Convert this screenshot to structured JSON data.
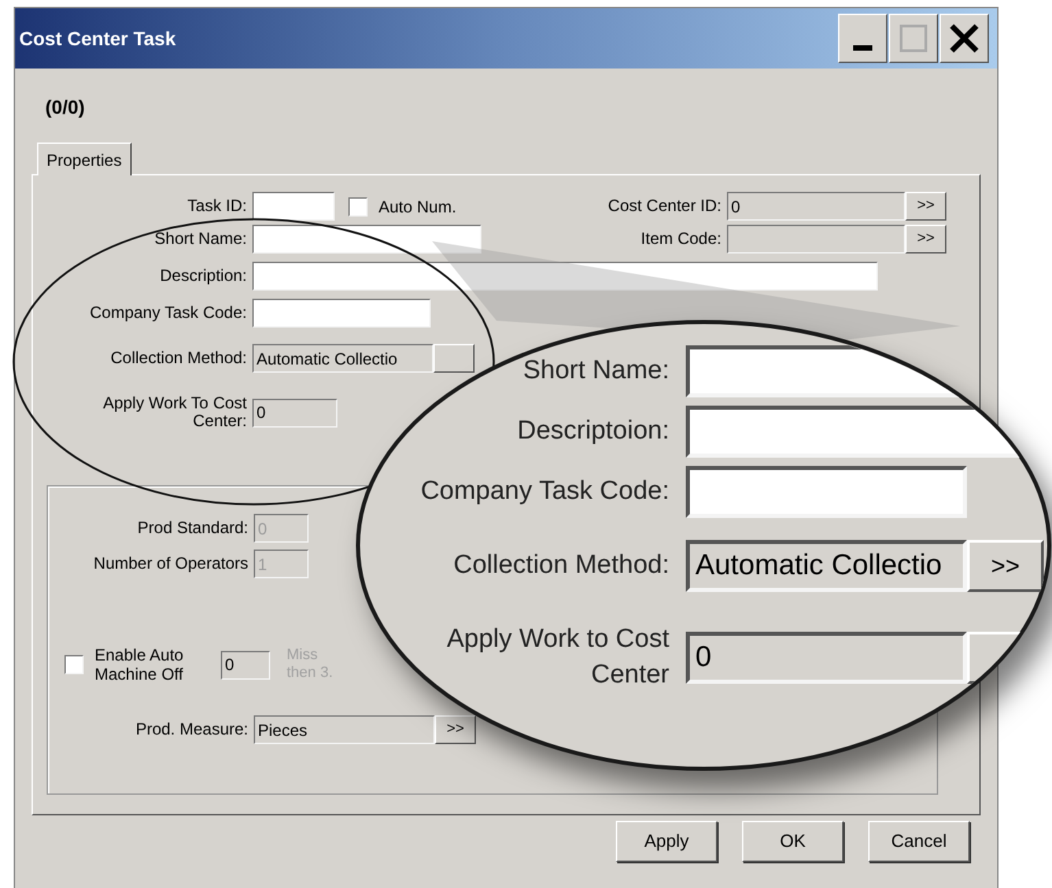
{
  "window": {
    "title": "Cost Center Task"
  },
  "record_counter": "(0/0)",
  "tabs": [
    {
      "label": "Properties",
      "selected": true
    }
  ],
  "task_id": {
    "label": "Task ID:"
  },
  "auto_num": {
    "label": "Auto Num.",
    "checked": false
  },
  "cost_center_id": {
    "label": "Cost Center ID:",
    "value": "0",
    "button": ">>"
  },
  "item_code": {
    "label": "Item Code:",
    "button": ">>"
  },
  "short_name": {
    "label": "Short Name:"
  },
  "description": {
    "label": "Description:"
  },
  "company_task_code": {
    "label": "Company Task Code:"
  },
  "collection_method": {
    "label": "Collection Method:",
    "value": "Automatic  Collectio"
  },
  "apply_work": {
    "label": "Apply Work To Cost Center:",
    "value": "0"
  },
  "production": {
    "prod_standard": {
      "label": "Prod Standard:",
      "value": "0",
      "disabled": true
    },
    "operators": {
      "label": "Number of Operators",
      "value": "1",
      "disabled": true
    },
    "auto_machine_off": {
      "label": "Enable Auto Machine Off",
      "checked": false,
      "value": "0",
      "hint": [
        "Miss",
        "then 3."
      ]
    },
    "prod_measure": {
      "label": "Prod. Measure:",
      "value": "Pieces",
      "button": ">>"
    }
  },
  "buttons": [
    "Apply",
    "OK",
    "Cancel"
  ],
  "magnifier": {
    "rows": [
      {
        "kind": "text",
        "label": "Short Name:"
      },
      {
        "kind": "text",
        "label": "Descriptoion:"
      },
      {
        "kind": "short",
        "label": "Company Task Code:"
      },
      {
        "kind": "lookup",
        "label": "Collection Method:",
        "value": "Automatic  Collectio",
        "button": ">>"
      },
      {
        "kind": "lookup",
        "label": "Apply Work to Cost Center",
        "value": "0"
      }
    ]
  }
}
